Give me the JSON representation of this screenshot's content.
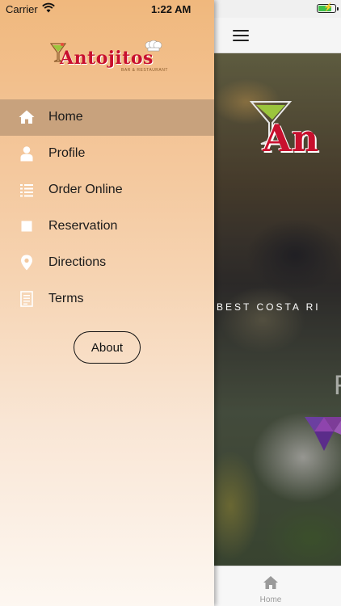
{
  "status_bar": {
    "carrier": "Carrier",
    "time": "1:22 AM",
    "battery_level": 0.72,
    "battery_charging": true
  },
  "brand": {
    "name": "Antojitos",
    "subtitle": "BAR & RESTAURANT",
    "color": "#c8102e"
  },
  "menu": {
    "items": [
      {
        "label": "Home",
        "icon": "home-icon",
        "active": true
      },
      {
        "label": "Profile",
        "icon": "person-icon",
        "active": false
      },
      {
        "label": "Order Online",
        "icon": "list-icon",
        "active": false
      },
      {
        "label": "Reservation",
        "icon": "square-icon",
        "active": false
      },
      {
        "label": "Directions",
        "icon": "location-pin-icon",
        "active": false
      },
      {
        "label": "Terms",
        "icon": "document-icon",
        "active": false
      }
    ],
    "active_color": "#c8a27d",
    "about_label": "About"
  },
  "hero": {
    "logo_text": "An",
    "tagline": "BEST COSTA RI",
    "partial_text": "F"
  },
  "tab_bar": {
    "home_label": "Home",
    "home_icon": "home-icon"
  }
}
